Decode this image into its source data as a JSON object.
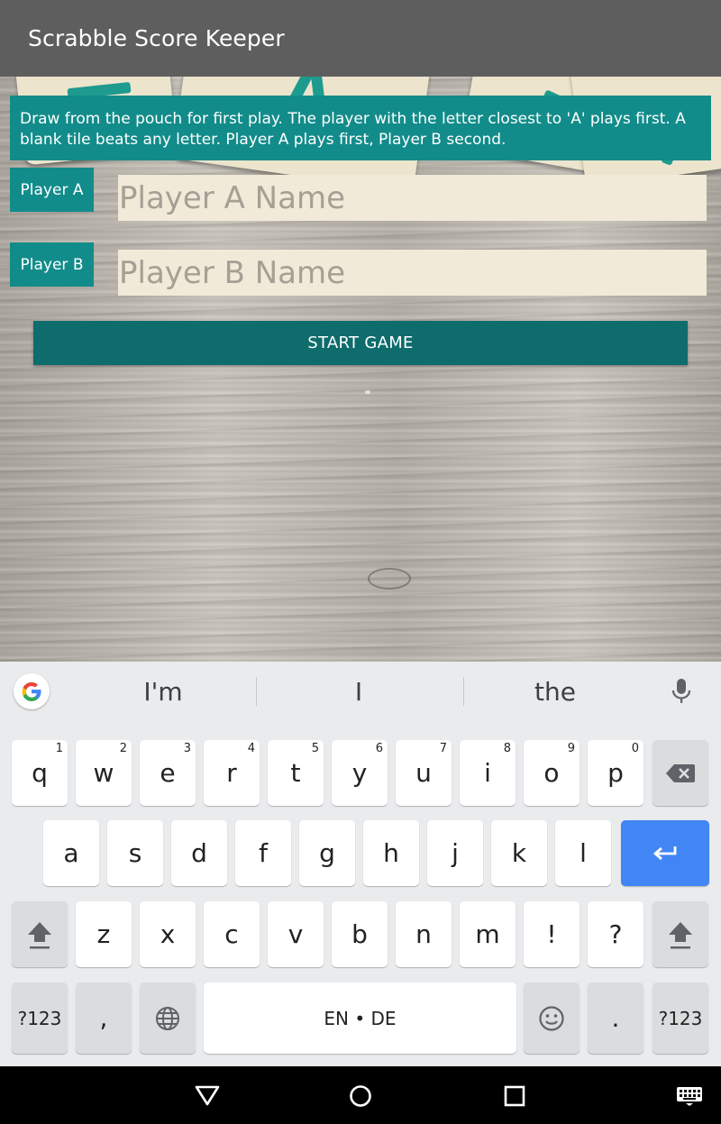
{
  "app": {
    "title": "Scrabble Score Keeper"
  },
  "intro": {
    "text": "Draw from the pouch for first play. The player with the letter closest to 'A' plays first. A blank tile beats any letter. Player A plays first, Player B second."
  },
  "players": [
    {
      "label": "Player A",
      "placeholder": "Player A Name",
      "value": ""
    },
    {
      "label": "Player B",
      "placeholder": "Player B Name",
      "value": ""
    }
  ],
  "start_button": {
    "label": "START GAME"
  },
  "keyboard": {
    "suggestions": [
      "I'm",
      "I",
      "the"
    ],
    "row1": [
      {
        "ch": "q",
        "num": "1"
      },
      {
        "ch": "w",
        "num": "2"
      },
      {
        "ch": "e",
        "num": "3"
      },
      {
        "ch": "r",
        "num": "4"
      },
      {
        "ch": "t",
        "num": "5"
      },
      {
        "ch": "y",
        "num": "6"
      },
      {
        "ch": "u",
        "num": "7"
      },
      {
        "ch": "i",
        "num": "8"
      },
      {
        "ch": "o",
        "num": "9"
      },
      {
        "ch": "p",
        "num": "0"
      }
    ],
    "row2": [
      "a",
      "s",
      "d",
      "f",
      "g",
      "h",
      "j",
      "k",
      "l"
    ],
    "row3": [
      "z",
      "x",
      "c",
      "v",
      "b",
      "n",
      "m",
      "!",
      "?"
    ],
    "symbols_label": "?123",
    "comma": ",",
    "period": ".",
    "space_label": "EN • DE"
  },
  "colors": {
    "accent": "#128c8a",
    "button": "#0e6c6c",
    "appbar": "#5e5e5e",
    "enter_key": "#4285f4"
  },
  "icons": [
    "google-g-icon",
    "microphone-icon",
    "backspace-icon",
    "enter-icon",
    "shift-icon",
    "globe-icon",
    "emoji-icon",
    "nav-back-icon",
    "nav-home-icon",
    "nav-recents-icon",
    "keyboard-switch-icon"
  ]
}
